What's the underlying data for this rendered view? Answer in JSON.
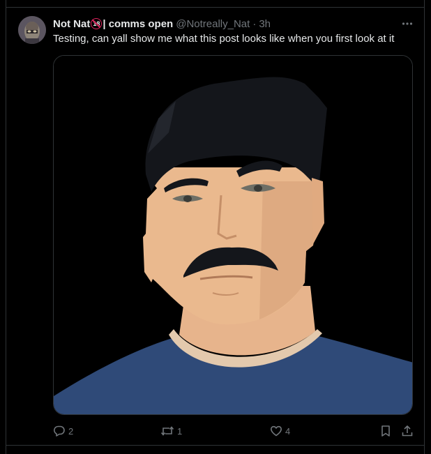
{
  "tweet": {
    "display_name": "Not Nat",
    "badge": "18",
    "name_suffix": "| comms open",
    "handle": "@Notreally_Nat",
    "separator": "·",
    "time": "3h",
    "text": "Testing, can yall show me what this post looks like when you first look at it",
    "media_description_icon": "cartoon-man-portrait"
  },
  "actions": {
    "reply_count": "2",
    "repost_count": "1",
    "like_count": "4"
  },
  "icons": {
    "more": "more-options-icon",
    "reply": "reply-icon",
    "repost": "repost-icon",
    "like": "heart-icon",
    "bookmark": "bookmark-icon",
    "share": "share-icon"
  },
  "colors": {
    "background": "#000000",
    "text": "#e7e9ea",
    "secondary": "#71767b",
    "border": "#2f3336",
    "badge_red": "#e0245e"
  }
}
